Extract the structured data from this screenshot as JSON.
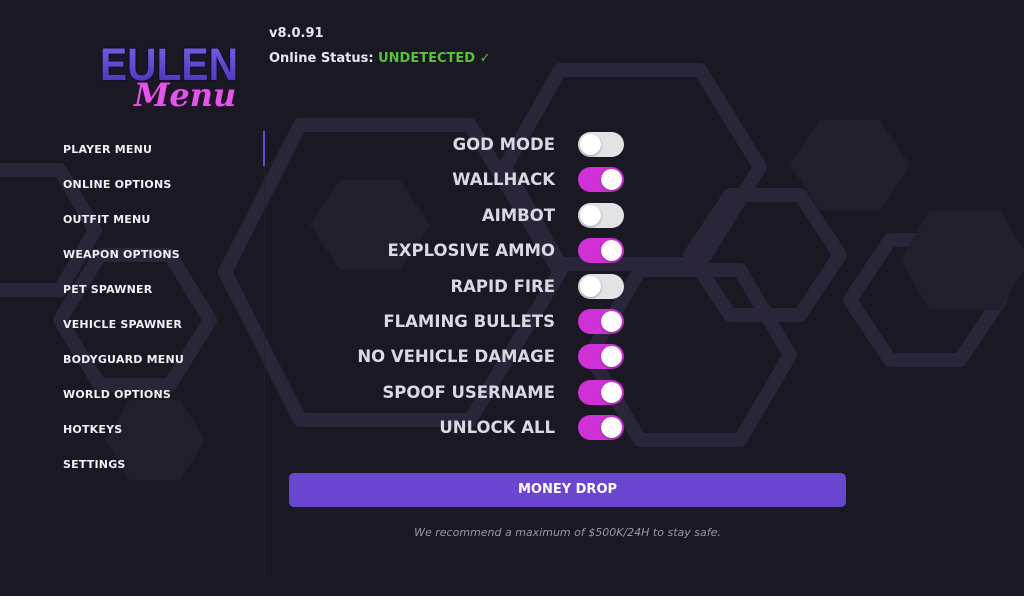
{
  "header": {
    "logo_top": "EULEN",
    "logo_bottom": "Menu",
    "version": "v8.0.91",
    "status_label": "Online Status:",
    "status_value": "UNDETECTED",
    "status_check": "✓"
  },
  "sidebar": {
    "items": [
      {
        "label": "PLAYER MENU",
        "active": true
      },
      {
        "label": "ONLINE OPTIONS"
      },
      {
        "label": "OUTFIT MENU"
      },
      {
        "label": "WEAPON OPTIONS"
      },
      {
        "label": "PET SPAWNER"
      },
      {
        "label": "VEHICLE SPAWNER"
      },
      {
        "label": "BODYGUARD MENU"
      },
      {
        "label": "WORLD OPTIONS"
      },
      {
        "label": "HOTKEYS"
      },
      {
        "label": "SETTINGS"
      }
    ]
  },
  "options": [
    {
      "label": "GOD MODE",
      "enabled": false
    },
    {
      "label": "WALLHACK",
      "enabled": true
    },
    {
      "label": "AIMBOT",
      "enabled": false
    },
    {
      "label": "EXPLOSIVE AMMO",
      "enabled": true
    },
    {
      "label": "RAPID FIRE",
      "enabled": false
    },
    {
      "label": "FLAMING BULLETS",
      "enabled": true
    },
    {
      "label": "NO VEHICLE DAMAGE",
      "enabled": true
    },
    {
      "label": "SPOOF USERNAME",
      "enabled": true
    },
    {
      "label": "UNLOCK ALL",
      "enabled": true
    }
  ],
  "money_drop": {
    "label": "MONEY DROP",
    "note": "We recommend a maximum of $500K/24H to stay safe."
  },
  "colors": {
    "background": "#1a1822",
    "accent_purple": "#6a45d0",
    "toggle_on": "#cf31d7",
    "toggle_off": "#e3e3e6",
    "status_green": "#58c23a"
  }
}
